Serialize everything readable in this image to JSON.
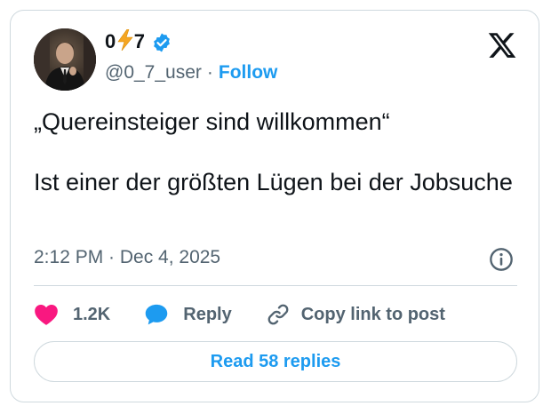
{
  "author": {
    "display_name_prefix": "0",
    "display_name_suffix": "7",
    "display_name_emoji": "high-voltage-icon",
    "verified": true,
    "handle": "@0_7_user",
    "separator": "·",
    "follow_label": "Follow"
  },
  "tweet": {
    "line1": "„Quereinsteiger sind willkommen“",
    "line2": "Ist einer der größten Lügen bei der Jobsuche",
    "timestamp": "2:12 PM · Dec 4, 2025"
  },
  "actions": {
    "like_count": "1.2K",
    "reply_label": "Reply",
    "copy_link_label": "Copy link to post"
  },
  "read_replies_label": "Read 58 replies",
  "colors": {
    "accent": "#1d9bf0",
    "like": "#f91880",
    "reply": "#1d9bf0",
    "text": "#0f1419",
    "muted": "#536471",
    "border": "#cfd9de"
  }
}
